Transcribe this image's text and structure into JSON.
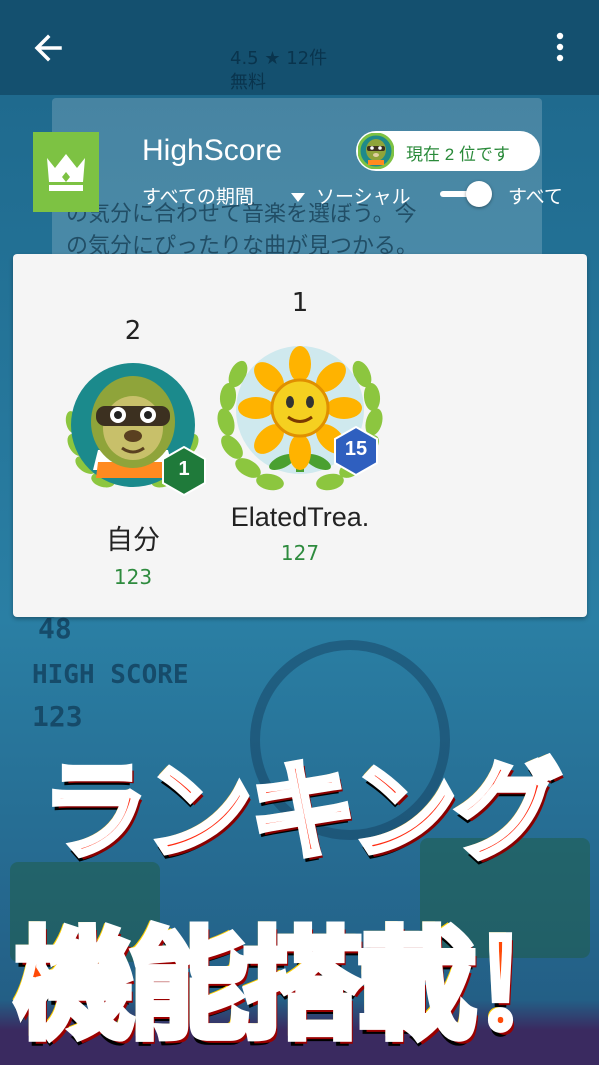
{
  "app_bar": {
    "back_icon": "arrow-back-icon",
    "menu_icon": "more-vert-icon"
  },
  "leaderboard": {
    "title": "HighScore",
    "icon": "crown-icon",
    "rank_status": "現在 2 位です",
    "period_selector": "すべての期間",
    "filter_social": "ソーシャル",
    "filter_all": "すべて",
    "toggle_state": "all",
    "entries": [
      {
        "rank": "2",
        "name": "自分",
        "score": "123",
        "level": "1",
        "avatar": "sloth-avatar"
      },
      {
        "rank": "1",
        "name": "ElatedTrea.",
        "score": "127",
        "level": "15",
        "avatar": "sunflower-avatar"
      }
    ]
  },
  "background": {
    "text_line1": "の気分に合わせて音楽を選ぼう。今",
    "text_line2": "の気分にぴったりな曲が見つかる。",
    "header_line": "4.5 ★ 12件",
    "free_label": "無料",
    "score_top": "48",
    "score_label": "HIGH SCORE",
    "score_value": "123"
  },
  "promo": {
    "line1": "ランキング",
    "line2": "機能搭載！"
  },
  "colors": {
    "accent_green": "#7dc243",
    "score_green": "#2e8b3e",
    "badge_green": "#1f7a3a",
    "badge_blue": "#2f5fbf",
    "promo_red": "#ff2a10"
  }
}
